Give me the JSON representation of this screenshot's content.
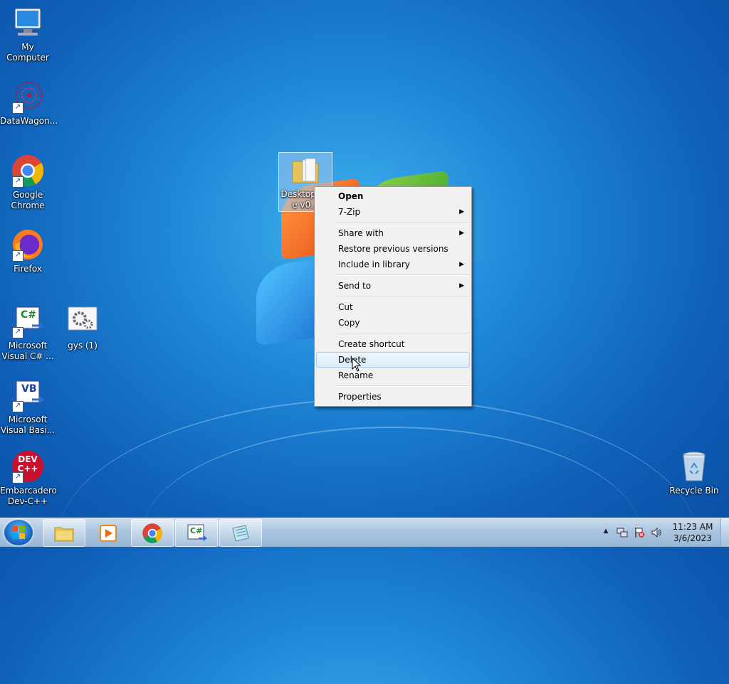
{
  "desktop": {
    "icons": [
      {
        "label": "My Computer"
      },
      {
        "label": "DataWagon..."
      },
      {
        "label": "Google Chrome"
      },
      {
        "label": "Firefox"
      },
      {
        "label": "Microsoft Visual C# ..."
      },
      {
        "label": "gys (1)"
      },
      {
        "label": "Microsoft Visual Basi..."
      },
      {
        "label": "Embarcadero Dev-C++"
      },
      {
        "label": "Recycle Bin"
      },
      {
        "label": "DesktopC... e v0..."
      }
    ],
    "icon_badges": {
      "csharp": "C#",
      "vb": "VB",
      "dev": "DEV\nC++"
    }
  },
  "context_menu": {
    "items": [
      {
        "label": "Open",
        "bold": true
      },
      {
        "label": "7-Zip",
        "submenu": true
      },
      {
        "label": "Share with",
        "submenu": true
      },
      {
        "label": "Restore previous versions"
      },
      {
        "label": "Include in library",
        "submenu": true
      },
      {
        "label": "Send to",
        "submenu": true
      },
      {
        "label": "Cut"
      },
      {
        "label": "Copy"
      },
      {
        "label": "Create shortcut"
      },
      {
        "label": "Delete",
        "hover": true
      },
      {
        "label": "Rename"
      },
      {
        "label": "Properties"
      }
    ]
  },
  "taskbar": {
    "pinned": [
      "file-explorer",
      "media-player",
      "chrome",
      "visual-csharp",
      "notepad"
    ],
    "tray_badge": "C#",
    "clock": {
      "time": "11:23 AM",
      "date": "3/6/2023"
    }
  },
  "colors": {
    "accent": "#1e86d6",
    "taskbar": "#a7c3df",
    "menu_bg": "#f1f1f1"
  }
}
